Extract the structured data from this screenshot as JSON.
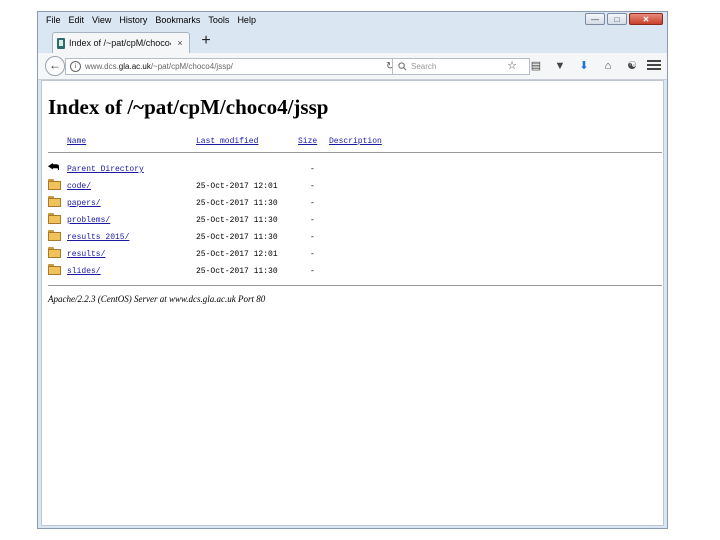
{
  "menu": [
    "File",
    "Edit",
    "View",
    "History",
    "Bookmarks",
    "Tools",
    "Help"
  ],
  "window_controls": {
    "minimize": "—",
    "maximize": "□",
    "close": "✕"
  },
  "tab": {
    "title": "Index of /~pat/cpM/choco4...",
    "close": "×",
    "new_tab": "+"
  },
  "navbar": {
    "url_prefix": "www.dcs.",
    "url_domain": "gla.ac.uk",
    "url_suffix": "/~pat/cpM/choco4/jssp/",
    "search_placeholder": "Search"
  },
  "page": {
    "heading": "Index of /~pat/cpM/choco4/jssp",
    "columns": {
      "name": "Name",
      "last_modified": "Last modified",
      "size": "Size",
      "description": "Description"
    },
    "entries": [
      {
        "icon": "back-icon",
        "name": "Parent Directory",
        "date": "",
        "size": "-"
      },
      {
        "icon": "folder-icon",
        "name": "code/",
        "date": "25-Oct-2017 12:01",
        "size": "-"
      },
      {
        "icon": "folder-icon",
        "name": "papers/",
        "date": "25-Oct-2017 11:30",
        "size": "-"
      },
      {
        "icon": "folder-icon",
        "name": "problems/",
        "date": "25-Oct-2017 11:30",
        "size": "-"
      },
      {
        "icon": "folder-icon",
        "name": "results 2015/",
        "date": "25-Oct-2017 11:30",
        "size": "-"
      },
      {
        "icon": "folder-icon",
        "name": "results/",
        "date": "25-Oct-2017 12:01",
        "size": "-"
      },
      {
        "icon": "folder-icon",
        "name": "slides/",
        "date": "25-Oct-2017 11:30",
        "size": "-"
      }
    ],
    "footer": "Apache/2.2.3 (CentOS) Server at www.dcs.gla.ac.uk Port 80"
  }
}
